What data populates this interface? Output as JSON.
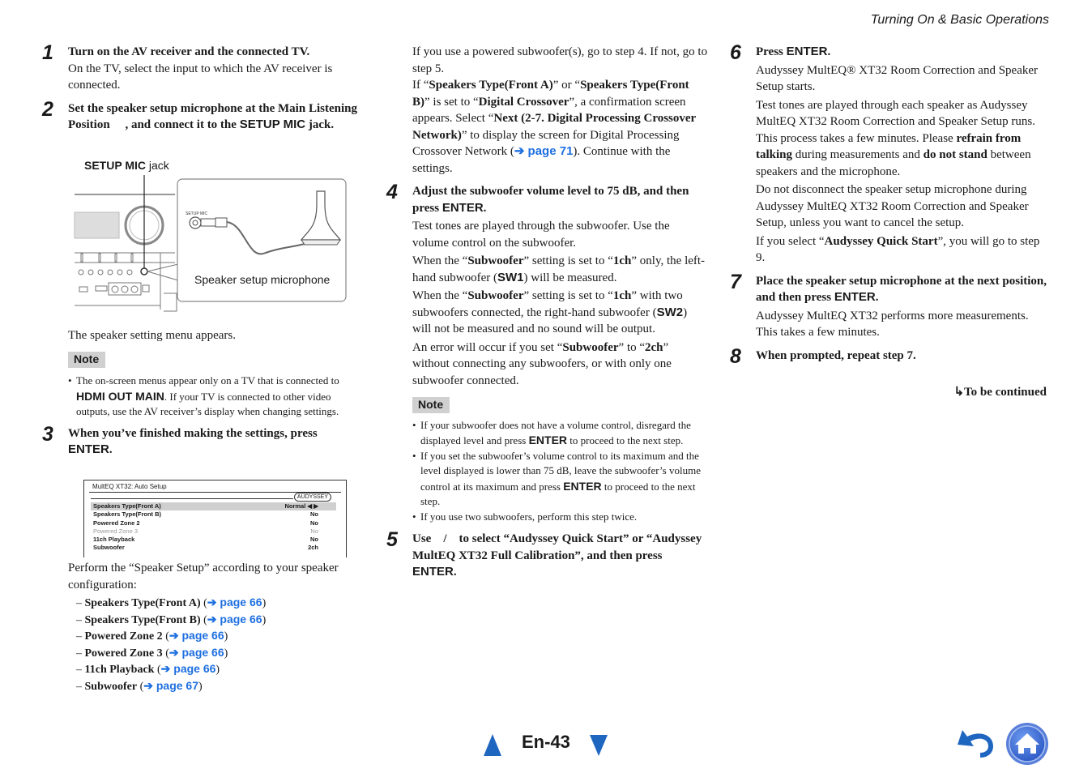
{
  "header": {
    "section_title": "Turning On & Basic Operations"
  },
  "col1": {
    "step1": {
      "num": "1",
      "title": "Turn on the AV receiver and the connected TV.",
      "body": "On the TV, select the input to which the AV receiver is connected."
    },
    "step2": {
      "num": "2",
      "title_a": "Set the speaker setup microphone at the Main Listening Position",
      "title_b": ", and connect it to the ",
      "title_key": "SETUP MIC",
      "title_c": " jack."
    },
    "figure": {
      "jack_label_key": "SETUP MIC",
      "jack_label_rest": " jack",
      "mic_caption": "Speaker setup microphone",
      "jack_small_label": "SETUP MIC"
    },
    "after_fig": "The speaker setting menu appears.",
    "note": {
      "label": "Note",
      "items": [
        {
          "a": "The on-screen menus appear only on a TV that is connected to ",
          "key": "HDMI OUT MAIN",
          "b": ". If your TV is connected to other video outputs, use the AV receiver’s display when changing settings."
        }
      ]
    },
    "step3": {
      "num": "3",
      "title": "When you’ve finished making the settings, press ",
      "key": "ENTER",
      "end": "."
    },
    "screen": {
      "title": "MultEQ XT32: Auto Setup",
      "logo": "AUDYSSEY",
      "rows": [
        {
          "label": "Speakers Type(Front A)",
          "value": "Normal ◀ ▶",
          "selected": true,
          "dim": false
        },
        {
          "label": "Speakers Type(Front B)",
          "value": "No",
          "selected": false,
          "dim": false
        },
        {
          "label": "Powered Zone 2",
          "value": "No",
          "selected": false,
          "dim": false
        },
        {
          "label": "Powered Zone 3",
          "value": "No",
          "selected": false,
          "dim": true
        },
        {
          "label": "11ch Playback",
          "value": "No",
          "selected": false,
          "dim": false
        },
        {
          "label": "Subwoofer",
          "value": "2ch",
          "selected": false,
          "dim": false
        }
      ]
    },
    "perform_text": "Perform the “Speaker Setup” according to your speaker configuration:",
    "config_list": [
      {
        "label": "Speakers Type(Front A)",
        "link": "➔ page 66"
      },
      {
        "label": "Speakers Type(Front B)",
        "link": "➔ page 66"
      },
      {
        "label": "Powered Zone 2",
        "link": "➔ page 66"
      },
      {
        "label": "Powered Zone 3",
        "link": "➔ page 66"
      },
      {
        "label": "11ch Playback",
        "link": "➔ page 66"
      },
      {
        "label": "Subwoofer",
        "link": "➔ page 67"
      }
    ]
  },
  "col2": {
    "intro1": "If you use a powered subwoofer(s), go to step 4. If not, go to step 5.",
    "intro2": {
      "a": "If “",
      "b1": "Speakers Type(Front A)",
      "c": "” or “",
      "b2": "Speakers Type(Front B)",
      "d": "” is set to “",
      "b3": "Digital Crossover",
      "e": "”, a confirmation screen appears. Select “",
      "b4": "Next (2-7. Digital Processing Crossover Network)",
      "f": "” to display the screen for Digital Processing Crossover Network (",
      "link": "➔ page 71",
      "g": "). Continue with the settings."
    },
    "step4": {
      "num": "4",
      "title": "Adjust the subwoofer volume level to 75 dB, and then press ",
      "key": "ENTER",
      "end": ".",
      "p1": "Test tones are played through the subwoofer. Use the volume control on the subwoofer.",
      "p2": {
        "a": "When the “",
        "b1": "Subwoofer",
        "c": "” setting is set to “",
        "b2": "1ch",
        "d": "” only, the left-hand subwoofer (",
        "key": "SW1",
        "e": ") will be measured."
      },
      "p3": {
        "a": "When the “",
        "b1": "Subwoofer",
        "c": "” setting is set to “",
        "b2": "1ch",
        "d": "” with two subwoofers connected, the right-hand subwoofer (",
        "key": "SW2",
        "e": ") will not be measured and no sound will be output."
      },
      "p4": {
        "a": "An error will occur if you set “",
        "b1": "Subwoofer",
        "c": "” to “",
        "b2": "2ch",
        "d": "” without connecting any subwoofers, or with only one subwoofer connected."
      }
    },
    "note": {
      "label": "Note",
      "items": [
        {
          "a": "If your subwoofer does not have a volume control, disregard the displayed level and press ",
          "key": "ENTER",
          "b": " to proceed to the next step."
        },
        {
          "a": "If you set the subwoofer’s volume control to its maximum and the level displayed is lower than 75 dB, leave the subwoofer’s volume control at its maximum and press ",
          "key": "ENTER",
          "b": " to proceed to the next step."
        },
        {
          "a": "If you use two subwoofers, perform this step twice.",
          "key": "",
          "b": ""
        }
      ]
    },
    "step5": {
      "num": "5",
      "title": "Use    /    to select “Audyssey Quick Start” or “Audyssey MultEQ XT32 Full Calibration”, and then press ",
      "key": "ENTER",
      "end": "."
    }
  },
  "col3": {
    "step6": {
      "num": "6",
      "title": "Press ",
      "key": "ENTER",
      "end": ".",
      "p1": "Audyssey MultEQ® XT32 Room Correction and Speaker Setup starts.",
      "p2": {
        "a": "Test tones are played through each speaker as Audyssey MultEQ XT32 Room Correction and Speaker Setup runs. This process takes a few minutes. Please ",
        "b1": "refrain from talking",
        "c": " during measurements and ",
        "b2": "do not stand",
        "d": " between speakers and the microphone."
      },
      "p3": "Do not disconnect the speaker setup microphone during Audyssey MultEQ XT32 Room Correction and Speaker Setup, unless you want to cancel the setup.",
      "p4": {
        "a": "If you select “",
        "b1": "Audyssey Quick Start",
        "c": "”, you will go to step 9."
      }
    },
    "step7": {
      "num": "7",
      "title": "Place the speaker setup microphone at the next position, and then press ",
      "key": "ENTER",
      "end": ".",
      "p1": "Audyssey MultEQ XT32 performs more measurements. This takes a few minutes."
    },
    "step8": {
      "num": "8",
      "title": "When prompted, repeat step 7."
    },
    "continued": {
      "arrow": "↳",
      "label": "To be continued"
    }
  },
  "footer": {
    "page_number": "En-43",
    "prev_icon": "triangle-up",
    "next_icon": "triangle-down",
    "back_icon": "return-arrow",
    "home_icon": "house",
    "accent_color": "#1f66c1"
  }
}
